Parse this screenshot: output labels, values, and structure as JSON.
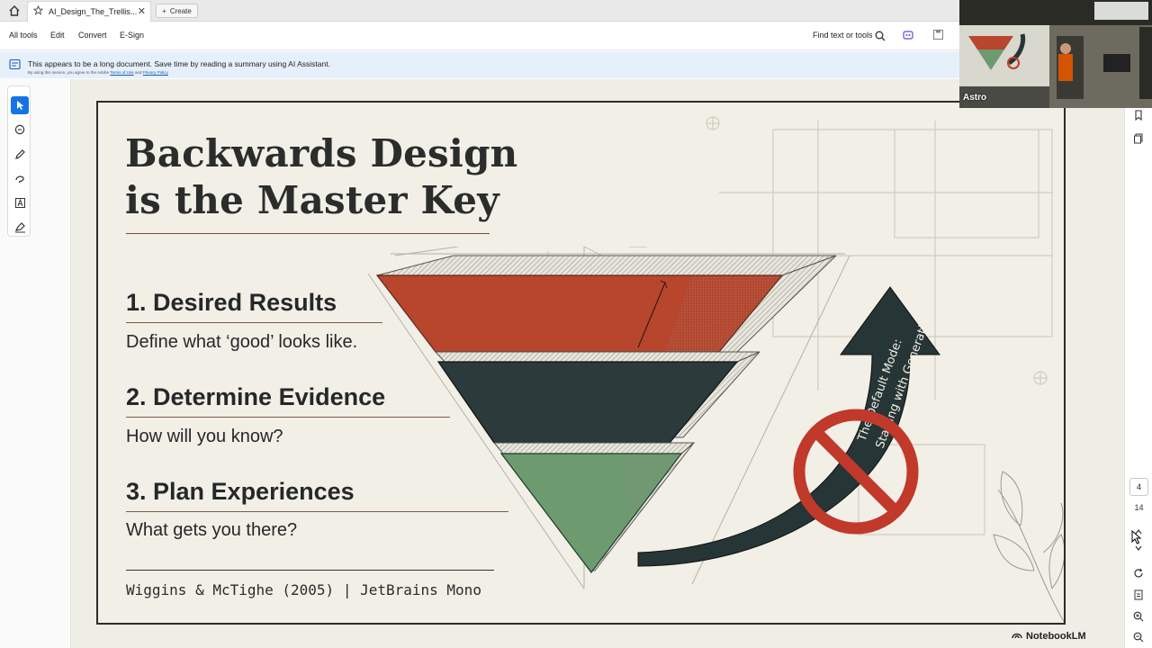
{
  "tabbar": {
    "home_icon": "home-icon",
    "tab_title": "AI_Design_The_Trellis...",
    "create_label": "Create"
  },
  "menubar": {
    "items": [
      "All tools",
      "Edit",
      "Convert",
      "E-Sign"
    ],
    "find_label": "Find text or tools"
  },
  "notice": {
    "message": "This appears to be a long document. Save time by reading a summary using AI Assistant.",
    "sub_prefix": "By using this service, you agree to the Adobe",
    "terms": "Terms of Use",
    "and": "and",
    "privacy": "Privacy Policy"
  },
  "slide": {
    "title_line1": "Backwards Design",
    "title_line2": "is the Master Key",
    "steps": [
      {
        "title": "1. Desired Results",
        "subtitle": "Define what ‘good’ looks like."
      },
      {
        "title": "2. Determine Evidence",
        "subtitle": "How will you know?"
      },
      {
        "title": "3. Plan Experiences",
        "subtitle": "What gets you there?"
      }
    ],
    "citation": "Wiggins & McTighe (2005) | JetBrains Mono",
    "arrow_text_line1": "The Default Mode:",
    "arrow_text_line2": "Starting with Generation.",
    "colors": {
      "red": "#b8462d",
      "dark": "#2b3a3a",
      "green": "#6e9a70"
    }
  },
  "pager": {
    "current": "4",
    "total": "14"
  },
  "video": {
    "name": "Astro"
  },
  "watermark": "NotebookLM"
}
